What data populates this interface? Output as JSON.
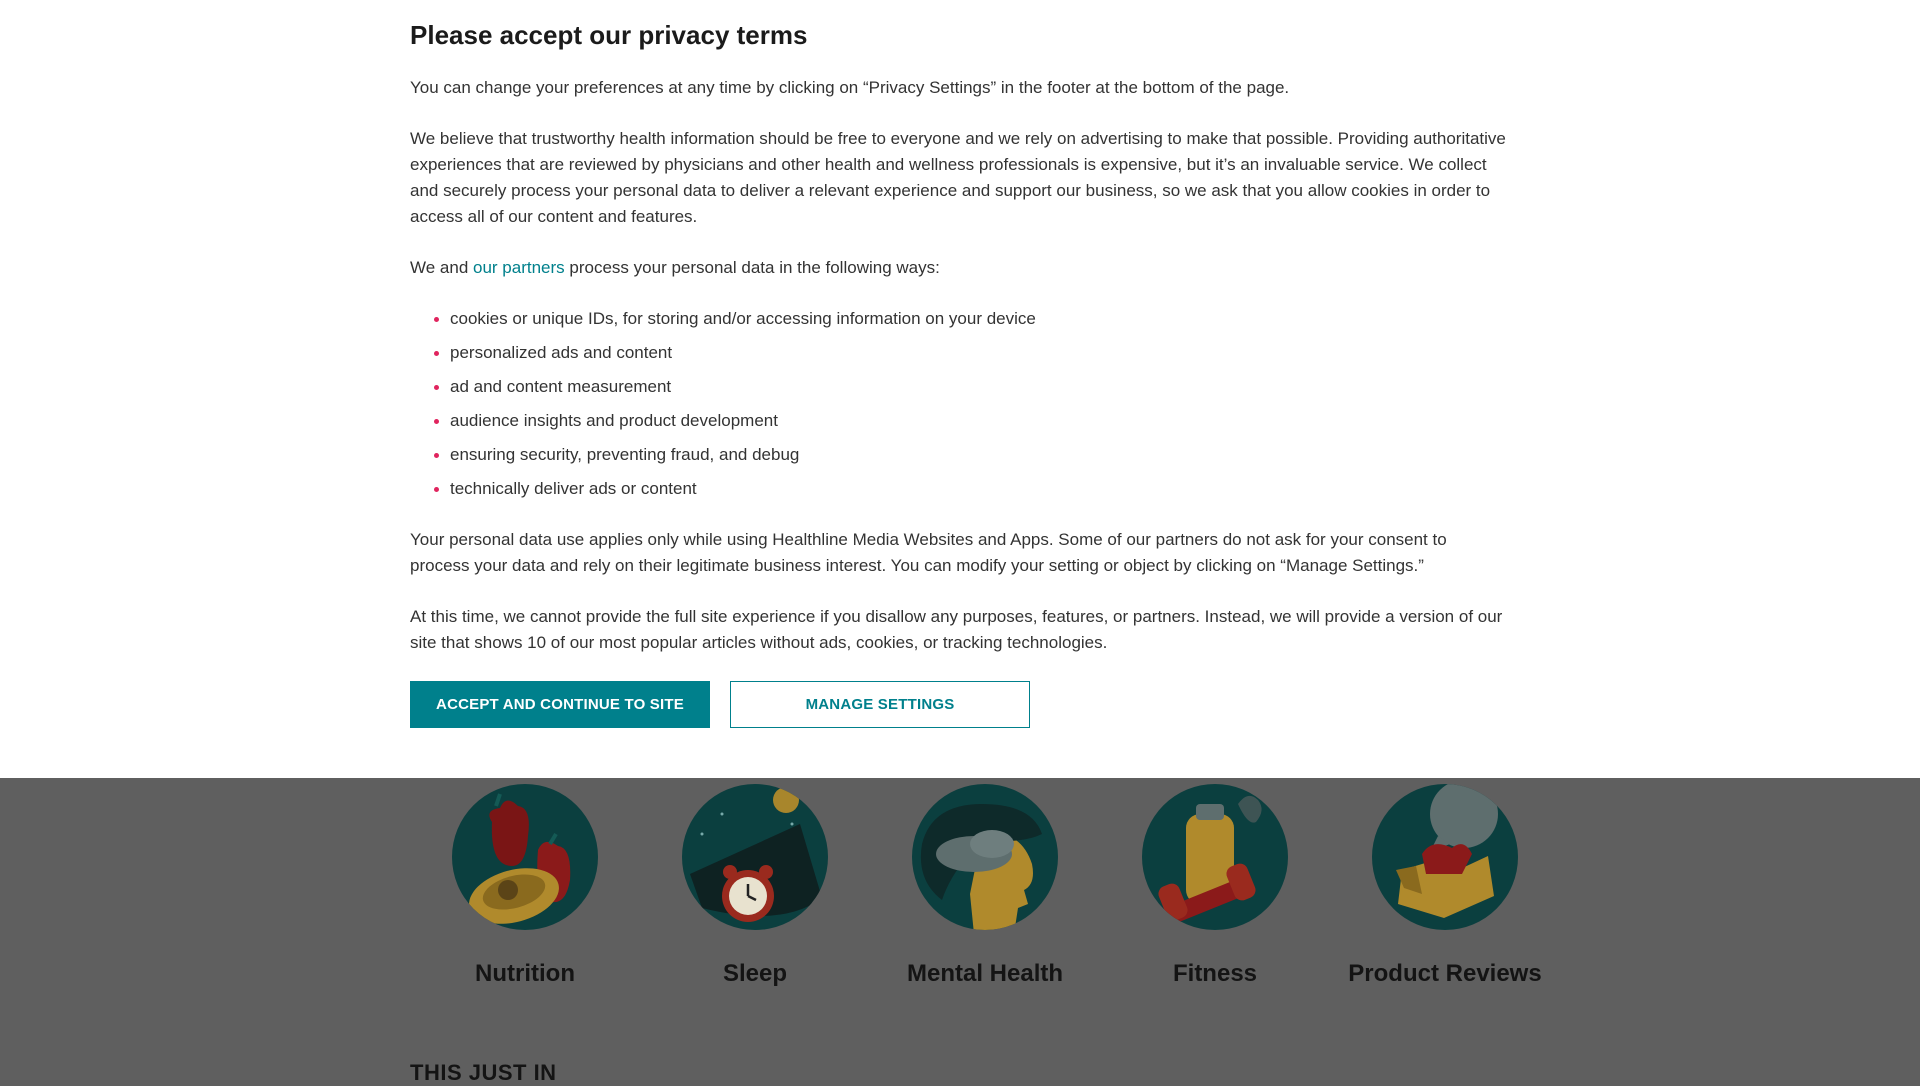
{
  "modal": {
    "title": "Please accept our privacy terms",
    "p1": "You can change your preferences at any time by clicking on “Privacy Settings” in the footer at the bottom of the page.",
    "p2": "We believe that trustworthy health information should be free to everyone and we rely on advertising to make that possible. Providing authoritative experiences that are reviewed by physicians and other health and wellness professionals is expensive, but it’s an invaluable service. We collect and securely process your personal data to deliver a relevant experience and support our business, so we ask that you allow cookies in order to access all of our content and features.",
    "p3_before": "We and ",
    "p3_link": "our partners",
    "p3_after": " process your personal data in the following ways:",
    "ways": [
      "cookies or unique IDs, for storing and/or accessing information on your device",
      "personalized ads and content",
      "ad and content measurement",
      "audience insights and product development",
      "ensuring security, preventing fraud, and debug",
      "technically deliver ads or content"
    ],
    "p4": "Your personal data use applies only while using Healthline Media Websites and Apps. Some of our partners do not ask for your consent to process your data and rely on their legitimate business interest. You can modify your setting or object by clicking on “Manage Settings.”",
    "p5": "At this time, we cannot provide the full site experience if you disallow any purposes, features, or partners. Instead, we will provide a version of our site that shows 10 of our most popular articles without ads, cookies, or tracking technologies.",
    "accept_label": "ACCEPT AND CONTINUE TO SITE",
    "manage_label": "MANAGE SETTINGS"
  },
  "topics": [
    {
      "label": "Nutrition",
      "icon": "nutrition-icon"
    },
    {
      "label": "Sleep",
      "icon": "sleep-icon"
    },
    {
      "label": "Mental Health",
      "icon": "mental-health-icon"
    },
    {
      "label": "Fitness",
      "icon": "fitness-icon"
    },
    {
      "label": "Product Reviews",
      "icon": "product-reviews-icon"
    }
  ],
  "section_heading": "THIS JUST IN",
  "colors": {
    "accent": "#00808c",
    "bullet": "#e0245e",
    "overlay": "#5e5e5e",
    "modal_bg": "#ffffff"
  }
}
